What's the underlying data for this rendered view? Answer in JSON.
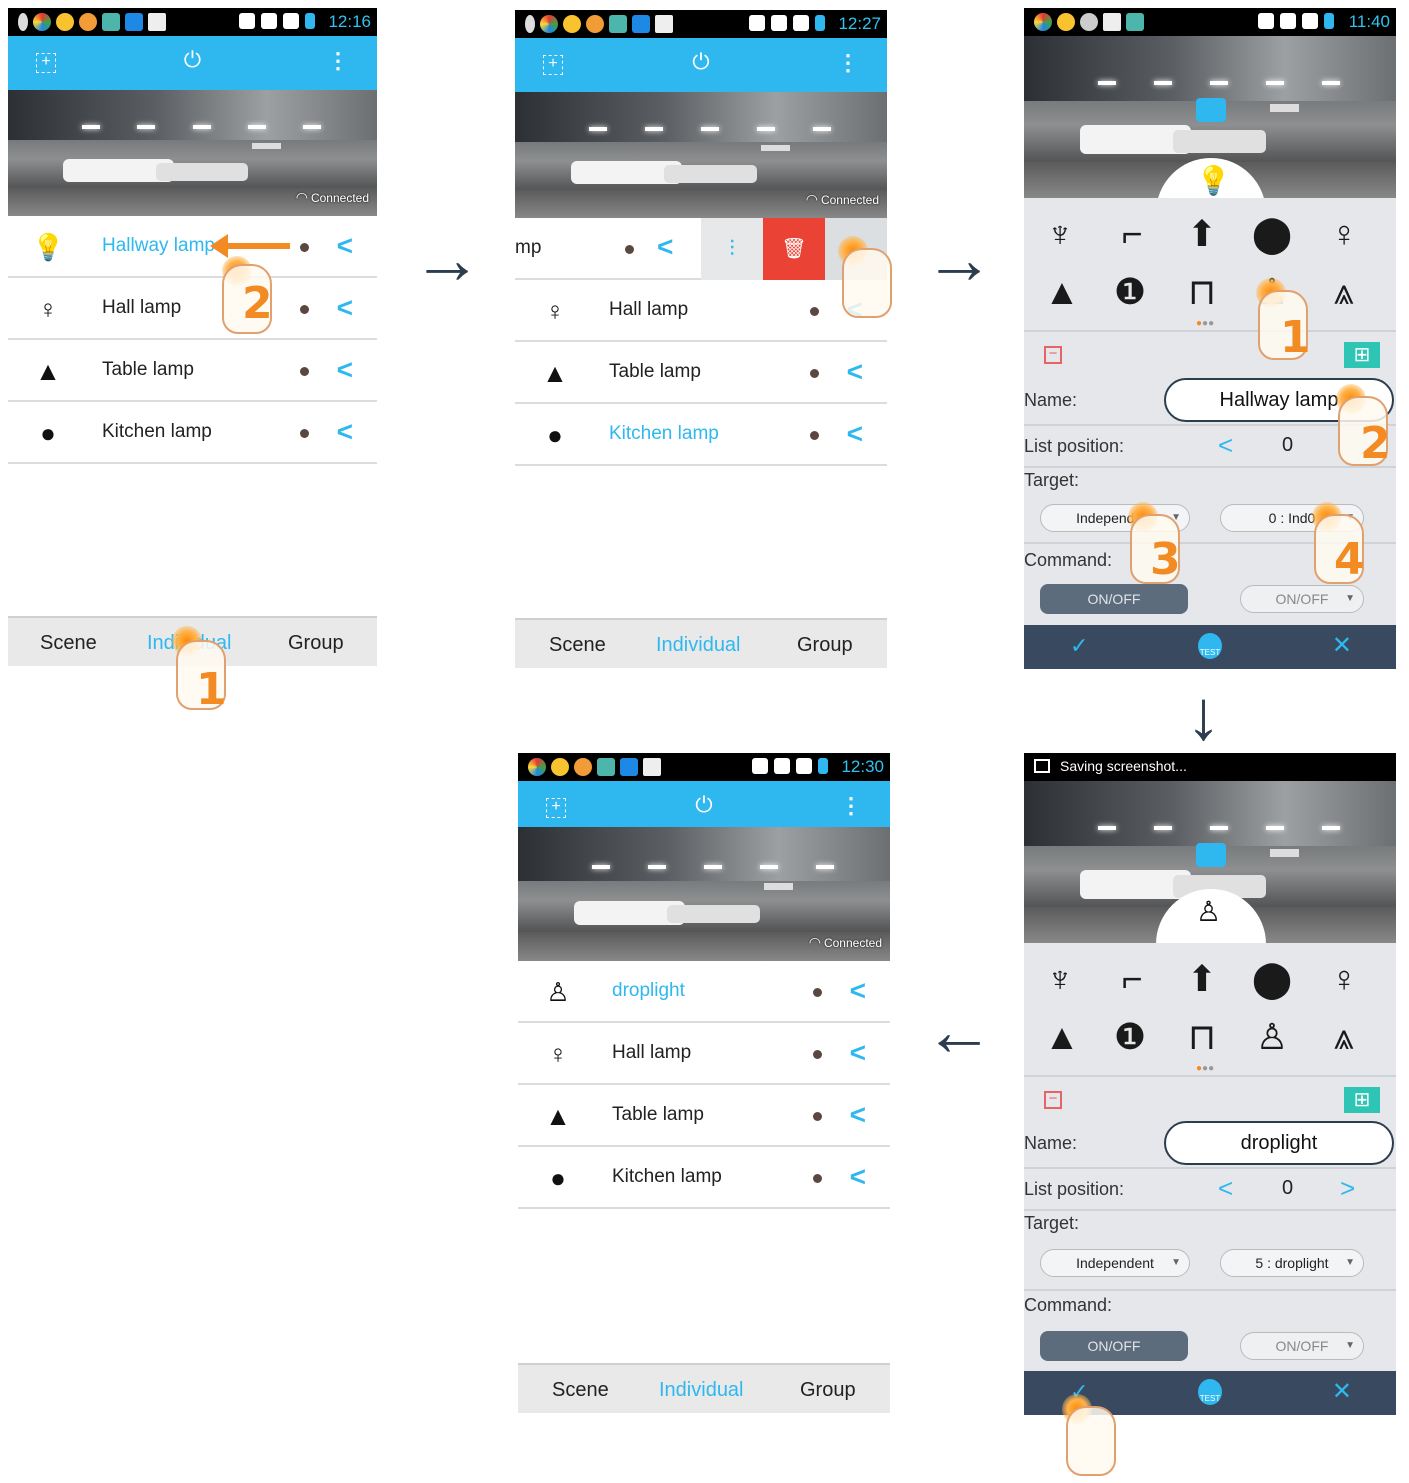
{
  "status": {
    "s1_time": "12:16",
    "s2_time": "12:27",
    "s3_time": "11:40",
    "s5_time": "12:30",
    "s4_message": "Saving screenshot..."
  },
  "connection_label": "Connected",
  "lamps_initial": [
    {
      "label": "Hallway lamp",
      "icon": "bulb-icon"
    },
    {
      "label": "Hall lamp",
      "icon": "lightbulb-outline-icon"
    },
    {
      "label": "Table lamp",
      "icon": "table-lamp-icon"
    },
    {
      "label": "Kitchen lamp",
      "icon": "numbered-bulb-icon"
    }
  ],
  "screen2": {
    "partial_label": "mp",
    "rows": [
      "Hall lamp",
      "Table lamp",
      "Kitchen lamp"
    ]
  },
  "lamps_final": [
    "droplight",
    "Hall lamp",
    "Table lamp",
    "Kitchen lamp"
  ],
  "nav": {
    "scene": "Scene",
    "individual": "Individual",
    "group": "Group"
  },
  "editor1": {
    "name_label": "Name:",
    "name_value": "Hallway lamp",
    "position_label": "List position:",
    "position_value": "0",
    "target_label": "Target:",
    "target_mode": "Independent",
    "target_id": "0 : Ind0",
    "command_label": "Command:",
    "command_button": "ON/OFF",
    "command_option": "ON/OFF",
    "test_label": "TEST"
  },
  "editor2": {
    "name_label": "Name:",
    "name_value": "droplight",
    "position_label": "List position:",
    "position_value": "0",
    "target_label": "Target:",
    "target_mode": "Independent",
    "target_id": "5 : droplight",
    "command_label": "Command:",
    "command_button": "ON/OFF",
    "command_option": "ON/OFF",
    "test_label": "TEST"
  },
  "steps": {
    "one": "1",
    "two": "2",
    "three": "3",
    "four": "4"
  },
  "colors": {
    "accent": "#2eb8ef",
    "footer": "#394a60",
    "delete": "#ea4335",
    "step": "#f28b24"
  }
}
